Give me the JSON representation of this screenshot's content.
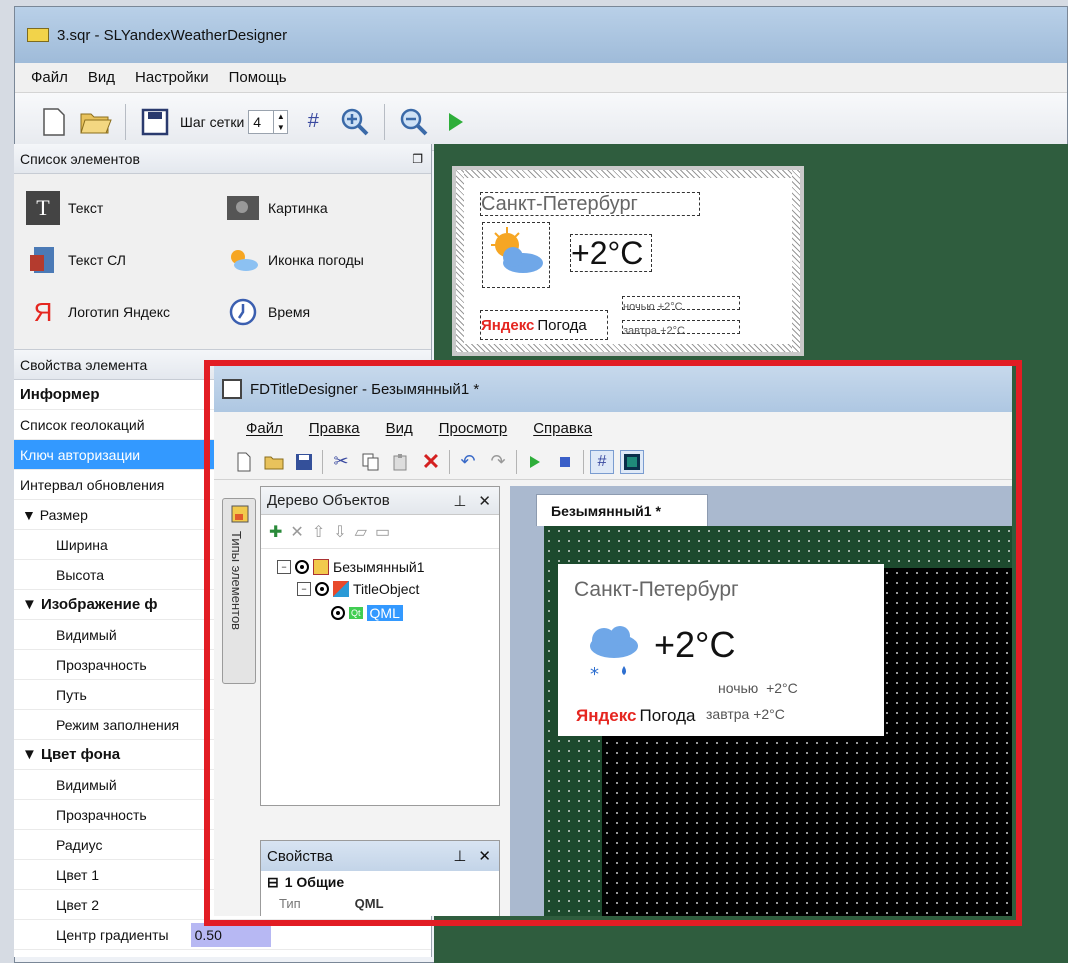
{
  "win1": {
    "title": "3.sqr - SLYandexWeatherDesigner",
    "menu": [
      "Файл",
      "Вид",
      "Настройки",
      "Помощь"
    ],
    "toolbar": {
      "grid_step_label": "Шаг сетки",
      "grid_step_value": "4"
    }
  },
  "elements_panel": {
    "title": "Список элементов",
    "items": [
      {
        "label": "Текст",
        "icon": "text-icon"
      },
      {
        "label": "Картинка",
        "icon": "image-icon"
      },
      {
        "label": "Текст СЛ",
        "icon": "sl-text-icon"
      },
      {
        "label": "Иконка погоды",
        "icon": "weather-icon"
      },
      {
        "label": "Логотип Яндекс",
        "icon": "yandex-logo-icon"
      },
      {
        "label": "Время",
        "icon": "clock-icon"
      }
    ],
    "yandex_glyph": "Я",
    "text_glyph": "T"
  },
  "props_panel": {
    "title": "Свойства элемента",
    "rows": [
      {
        "label": "Информер",
        "kind": "bold"
      },
      {
        "label": "Список геолокаций",
        "kind": "normal"
      },
      {
        "label": "Ключ авторизации",
        "kind": "selected"
      },
      {
        "label": "Интервал обновления",
        "kind": "normal"
      },
      {
        "label": "▼ Размер",
        "kind": "grp"
      },
      {
        "label": "Ширина",
        "kind": "sub"
      },
      {
        "label": "Высота",
        "kind": "sub"
      },
      {
        "label": "▼ Изображение ф",
        "kind": "bold-grp"
      },
      {
        "label": "Видимый",
        "kind": "sub"
      },
      {
        "label": "Прозрачность",
        "kind": "sub"
      },
      {
        "label": "Путь",
        "kind": "sub"
      },
      {
        "label": "Режим заполнения",
        "kind": "sub"
      },
      {
        "label": "▼ Цвет фона",
        "kind": "bold-grp"
      },
      {
        "label": "Видимый",
        "kind": "sub"
      },
      {
        "label": "Прозрачность",
        "kind": "sub"
      },
      {
        "label": "Радиус",
        "kind": "sub"
      },
      {
        "label": "Цвет 1",
        "kind": "sub"
      },
      {
        "label": "Цвет 2",
        "kind": "sub"
      },
      {
        "label": "Центр градиенты",
        "kind": "sub-val",
        "value": "0.50"
      }
    ]
  },
  "preview": {
    "city": "Санкт-Петербург",
    "temp": "+2°C",
    "night": "ночью +2°C",
    "tomorrow": "завтра +2°C",
    "brand_bold": "Яндекс",
    "brand_light": "Погода"
  },
  "win2": {
    "title": "FDTitleDesigner - Безымянный1 *",
    "menu": [
      "Файл",
      "Правка",
      "Вид",
      "Просмотр",
      "Справка"
    ],
    "side_tab": "Типы элементов",
    "tree_title": "Дерево Объектов",
    "tree_nodes": [
      "Безымянный1",
      "TitleObject",
      "QML"
    ],
    "qt_glyph": "Qt",
    "props_title": "Свойства",
    "props_group": "1 Общие",
    "props_type_label": "Тип",
    "props_type_value": "QML",
    "doc_tab": "Безымянный1 *",
    "card": {
      "city": "Санкт-Петербург",
      "temp": "+2°C",
      "night_label": "ночью",
      "night_temp": "+2°C",
      "tomorrow_label": "завтра",
      "tomorrow_temp": "+2°C",
      "brand_bold": "Яндекс",
      "brand_light": "Погода"
    }
  },
  "colors": {
    "selection": "#3399ff",
    "canvas_green": "#2f5d3e",
    "highlight_frame": "#e21d24",
    "weather_cloud": "#6fa7e8",
    "weather_sun": "#f6a623",
    "yandex_red": "#e52620"
  }
}
